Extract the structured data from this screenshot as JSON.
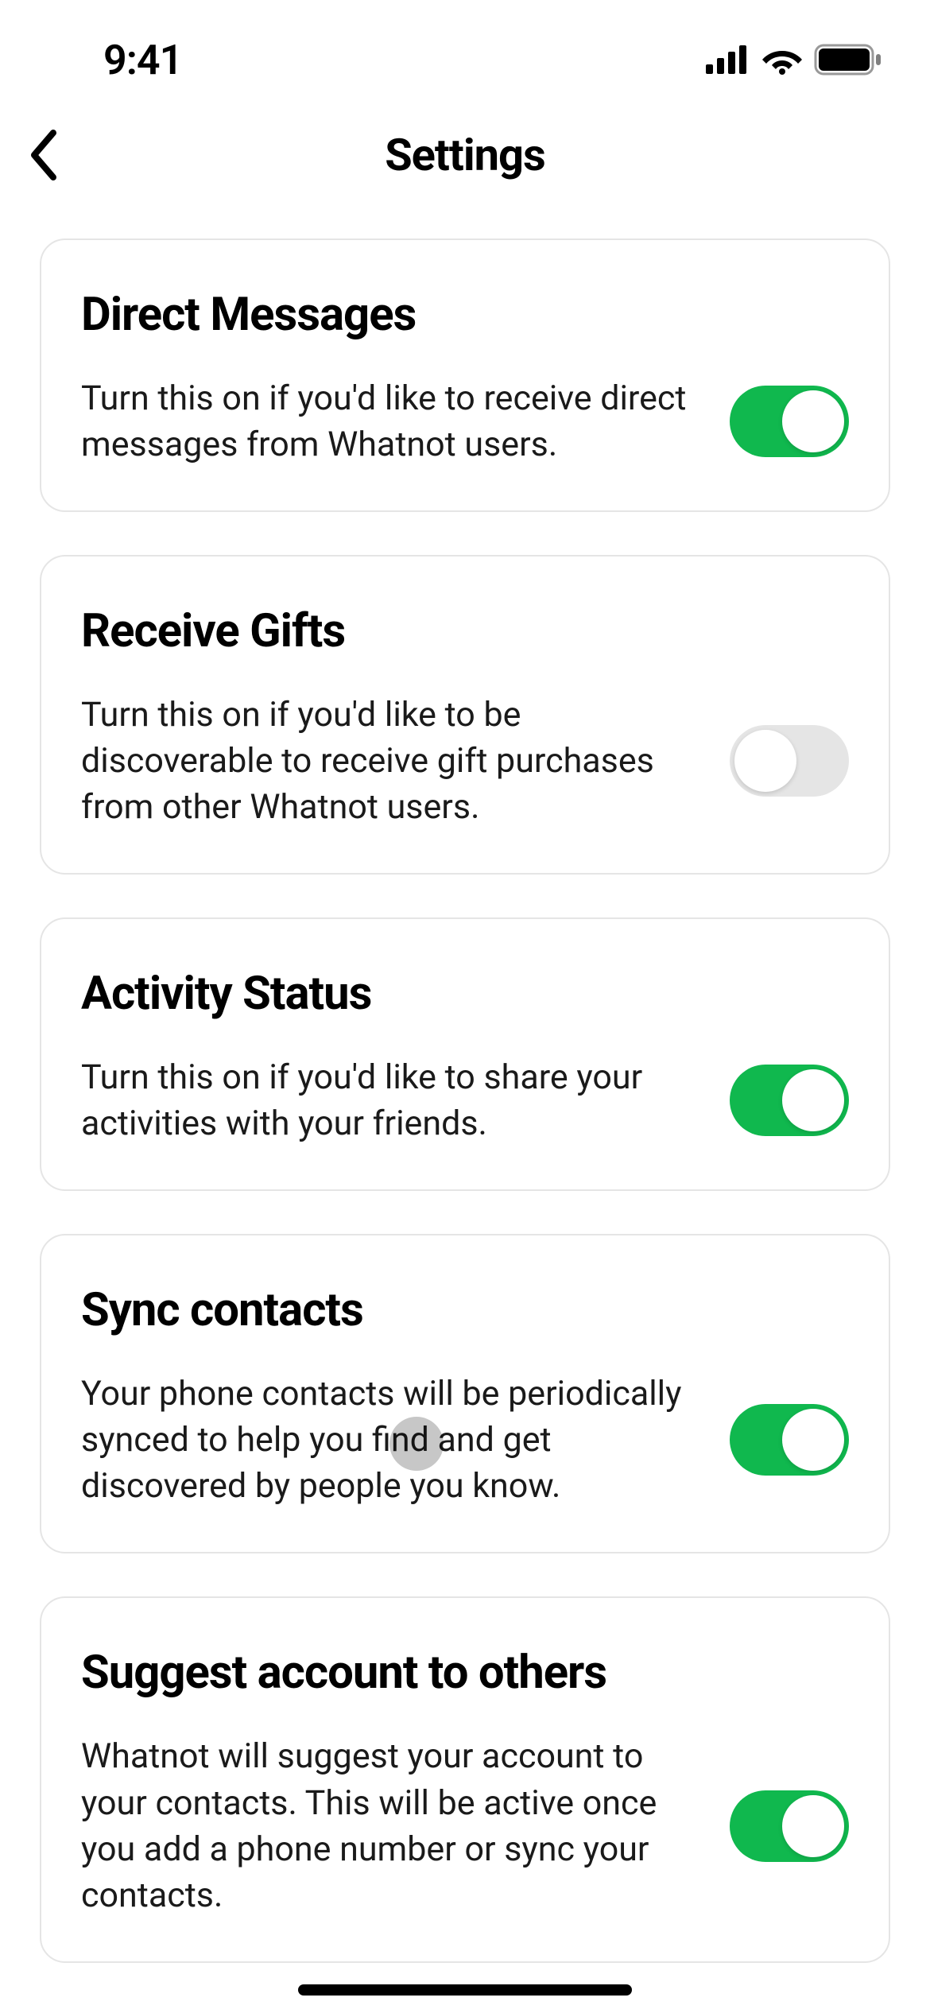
{
  "status_bar": {
    "time": "9:41"
  },
  "nav": {
    "title": "Settings"
  },
  "cards": [
    {
      "title": "Direct Messages",
      "description": "Turn this on if you'd like to receive direct messages from Whatnot users.",
      "toggle_on": true
    },
    {
      "title": "Receive Gifts",
      "description": "Turn this on if you'd like to be discoverable to receive gift purchases from other Whatnot users.",
      "toggle_on": false
    },
    {
      "title": "Activity Status",
      "description": "Turn this on if you'd like to share your activities with your friends.",
      "toggle_on": true
    },
    {
      "title": "Sync contacts",
      "description": "Your phone contacts will be periodically synced to help you find and get discovered by people you know.",
      "toggle_on": true
    },
    {
      "title": "Suggest account to others",
      "description": "Whatnot will suggest your account to your contacts. This will be active once you add a phone number or sync your contacts.",
      "toggle_on": true
    }
  ]
}
